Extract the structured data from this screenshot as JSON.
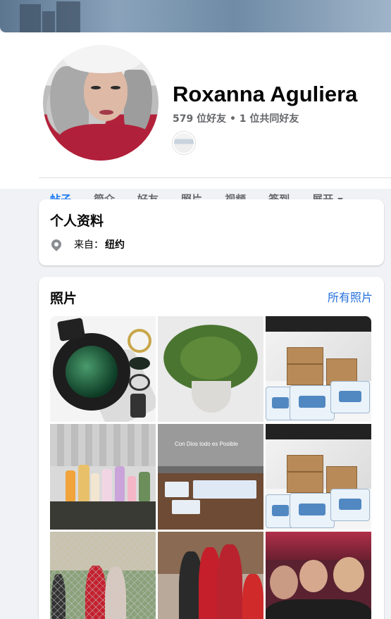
{
  "profile": {
    "name": "Roxanna Aguliera",
    "friends_text": "579 位好友 • 1 位共同好友"
  },
  "tabs": [
    {
      "label": "帖子",
      "active": true
    },
    {
      "label": "简介",
      "active": false
    },
    {
      "label": "好友",
      "active": false
    },
    {
      "label": "照片",
      "active": false
    },
    {
      "label": "视频",
      "active": false
    },
    {
      "label": "签到",
      "active": false
    },
    {
      "label": "展开",
      "active": false
    }
  ],
  "intro": {
    "title": "个人资料",
    "location_prefix": "来自：",
    "location_city": "纽约",
    "location_icon": "map-pin-icon"
  },
  "photos": {
    "title": "照片",
    "all_photos_link": "所有照片",
    "caption_in_photo": "Con Dios todo es Posible"
  },
  "colors": {
    "accent": "#1877f2",
    "link": "#216fdb",
    "background": "#f0f2f5"
  }
}
